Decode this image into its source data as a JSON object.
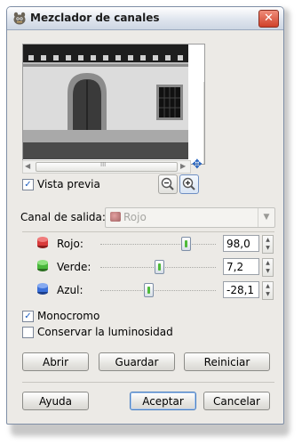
{
  "window": {
    "title": "Mezclador de canales",
    "app_icon": "gimp-icon",
    "close_glyph": "✕"
  },
  "preview": {
    "scroll_h_thumb_glyph": "III",
    "scroll_v_thumb_glyph": "≡",
    "show_preview_label": "Vista previa",
    "show_preview_checked": true
  },
  "output_channel": {
    "label": "Canal de salida:",
    "value": "Rojo",
    "disabled": true
  },
  "channels": [
    {
      "label": "Rojo:",
      "value": "98,0",
      "color": "#d83a3a",
      "slider_fraction": 0.74
    },
    {
      "label": "Verde:",
      "value": "7,2",
      "color": "#49b63b",
      "slider_fraction": 0.52
    },
    {
      "label": "Azul:",
      "value": "-28,1",
      "color": "#3a6fd8",
      "slider_fraction": 0.43
    }
  ],
  "options": {
    "monochrome_label": "Monocromo",
    "monochrome_checked": true,
    "preserve_luminosity_label": "Conservar la luminosidad",
    "preserve_luminosity_checked": false
  },
  "buttons": {
    "open": "Abrir",
    "save": "Guardar",
    "reset": "Reiniciar",
    "help": "Ayuda",
    "ok": "Aceptar",
    "cancel": "Cancelar"
  }
}
